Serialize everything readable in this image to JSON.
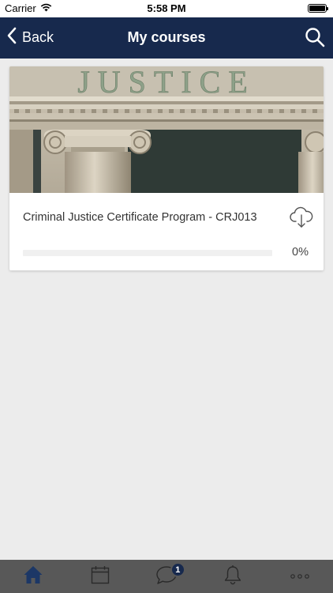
{
  "status_bar": {
    "carrier": "Carrier",
    "time": "5:58 PM"
  },
  "nav": {
    "back_label": "Back",
    "title": "My courses"
  },
  "courses": [
    {
      "title": "Criminal Justice Certificate Program - CRJ013",
      "image_text": "JUSTICE",
      "progress": 0,
      "progress_label": "0%"
    }
  ],
  "tabs": [
    {
      "name": "home",
      "icon": "home-icon",
      "active": true
    },
    {
      "name": "calendar",
      "icon": "calendar-icon"
    },
    {
      "name": "messages",
      "icon": "chat-bubble-icon",
      "badge": "1"
    },
    {
      "name": "notifications",
      "icon": "bell-icon"
    },
    {
      "name": "more",
      "icon": "more-dots-icon"
    }
  ],
  "colors": {
    "nav_background": "#17294d",
    "page_background": "#ececec",
    "tab_bar_background": "#585858",
    "active_tab": "#1c3766",
    "badge_background": "#17294d"
  }
}
